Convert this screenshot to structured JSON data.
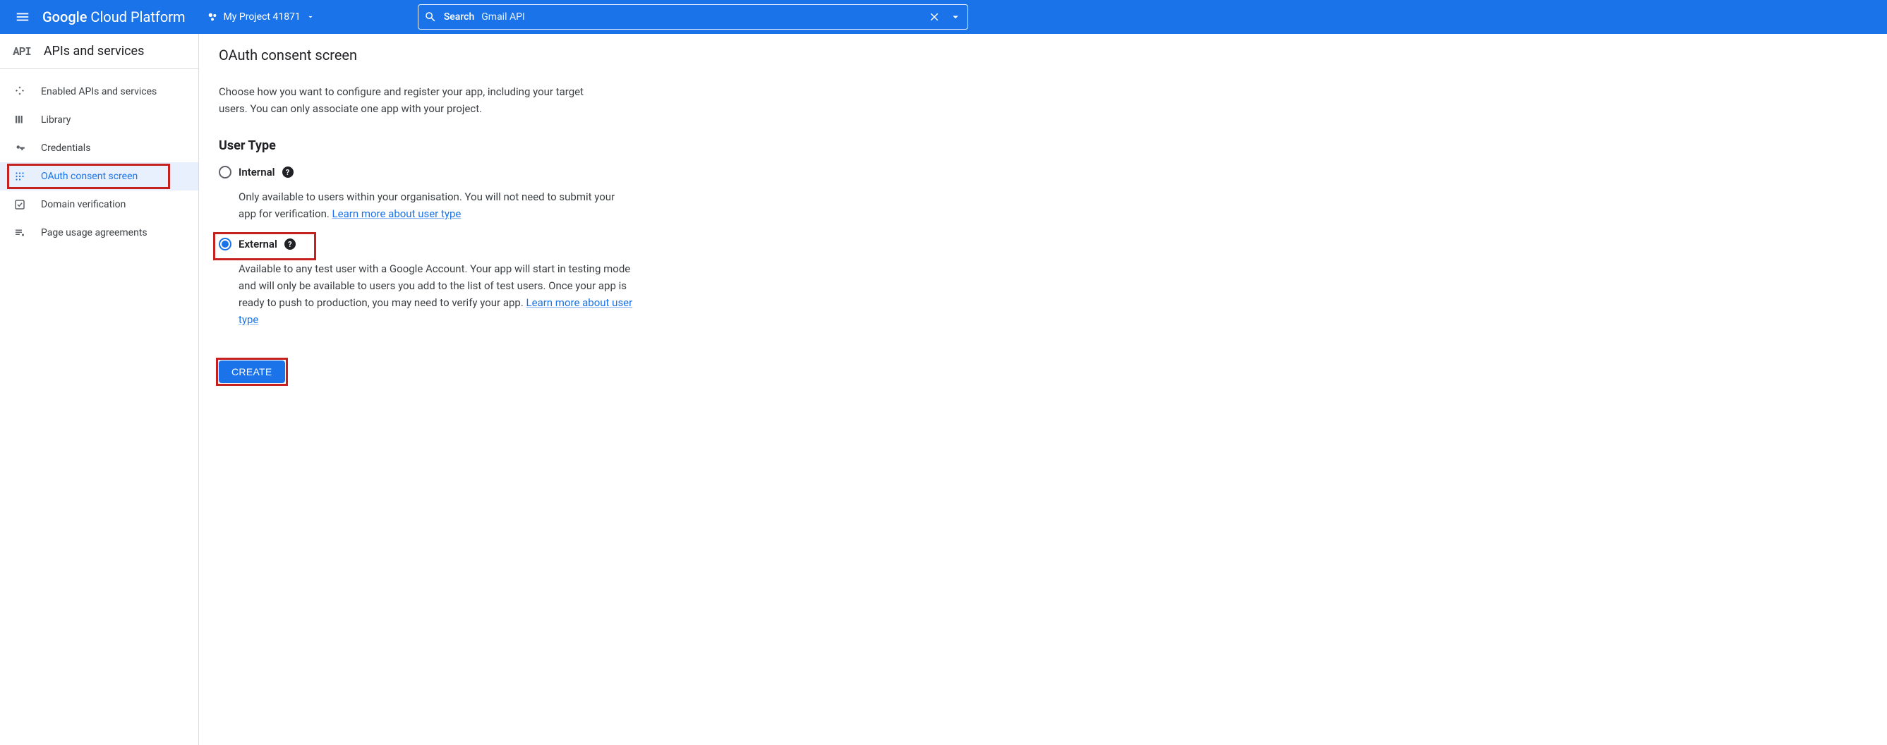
{
  "header": {
    "logo_prefix": "Google",
    "logo_rest": " Cloud Platform",
    "project_name": "My Project 41871",
    "search_label": "Search",
    "search_value": "Gmail API"
  },
  "sidebar": {
    "badge": "API",
    "title": "APIs and services",
    "items": [
      {
        "label": "Enabled APIs and services",
        "icon": "grid-icon",
        "active": false
      },
      {
        "label": "Library",
        "icon": "library-icon",
        "active": false
      },
      {
        "label": "Credentials",
        "icon": "key-icon",
        "active": false
      },
      {
        "label": "OAuth consent screen",
        "icon": "consent-icon",
        "active": true
      },
      {
        "label": "Domain verification",
        "icon": "check-icon",
        "active": false
      },
      {
        "label": "Page usage agreements",
        "icon": "agreement-icon",
        "active": false
      }
    ]
  },
  "main": {
    "title": "OAuth consent screen",
    "intro": "Choose how you want to configure and register your app, including your target users. You can only associate one app with your project.",
    "section_title": "User Type",
    "options": [
      {
        "label": "Internal",
        "checked": false,
        "desc": "Only available to users within your organisation. You will not need to submit your app for verification. ",
        "link_text": "Learn more about user type"
      },
      {
        "label": "External",
        "checked": true,
        "desc": "Available to any test user with a Google Account. Your app will start in testing mode and will only be available to users you add to the list of test users. Once your app is ready to push to production, you may need to verify your app. ",
        "link_text": "Learn more about user type"
      }
    ],
    "create_label": "CREATE"
  }
}
